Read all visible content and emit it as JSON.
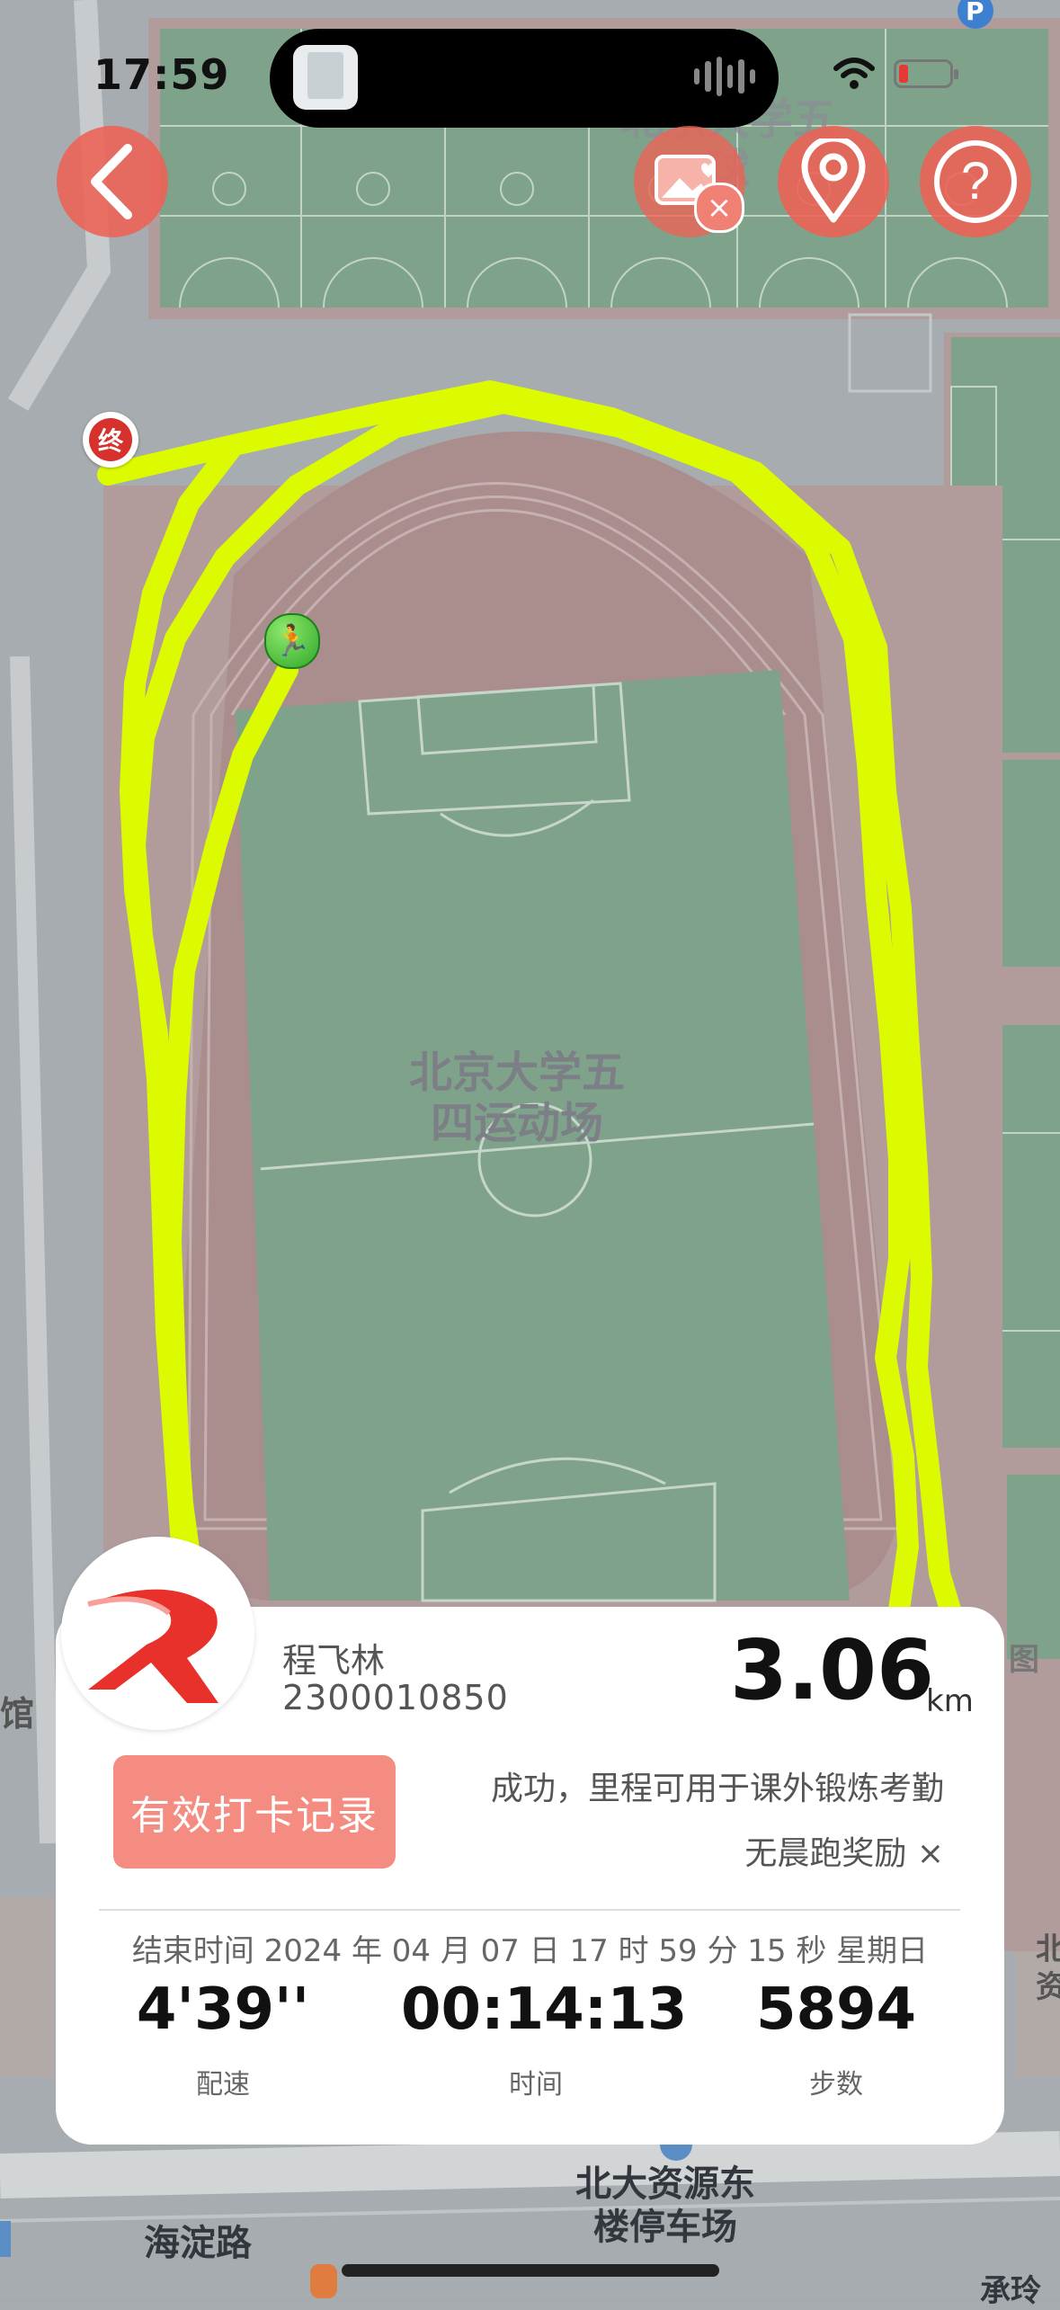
{
  "status_bar": {
    "time": "17:59"
  },
  "map": {
    "field_label_line1": "北京大学五",
    "field_label_line2": "四运动场",
    "top_court_label_line1": "北京大学五",
    "top_court_label_line2": "球",
    "parking_label_line1": "北大资源东",
    "parking_label_line2": "楼停车场",
    "road_label": "海淀路",
    "edge_label_left": "馆",
    "edge_label_right": "图",
    "edge_label_right2": "北",
    "edge_label_right3": "资",
    "bottom_right_label": "承玲",
    "end_marker_text": "终",
    "parking_icon": "P",
    "route_color": "#dcfb00"
  },
  "toolbar": {
    "back_icon": "chevron-left-icon",
    "photo_icon": "photo-heart-icon",
    "location_icon": "location-pin-icon",
    "help_icon": "question-icon",
    "help_glyph": "?"
  },
  "record": {
    "name": "程飞林",
    "student_id": "2300010850",
    "distance": "3.06",
    "distance_unit": "km",
    "valid_button": "有效打卡记录",
    "status": "成功，里程可用于课外锻炼考勤",
    "reward": "无晨跑奖励 ×",
    "end_time": "结束时间 2024 年 04 月 07 日 17 时 59 分 15 秒 星期日",
    "pace_value": "4'39''",
    "pace_label": "配速",
    "time_value": "00:14:13",
    "time_label": "时间",
    "steps_value": "5894",
    "steps_label": "步数"
  }
}
